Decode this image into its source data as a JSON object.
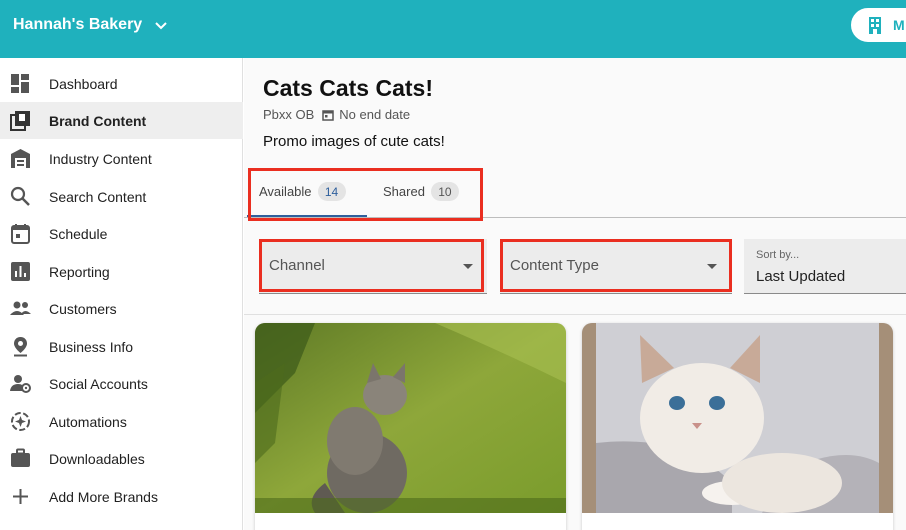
{
  "header": {
    "brand_name": "Hannah's Bakery",
    "location_button_label": "M"
  },
  "sidebar": {
    "items": [
      {
        "label": "Dashboard",
        "icon": "dashboard-icon"
      },
      {
        "label": "Brand Content",
        "icon": "library-icon",
        "active": true
      },
      {
        "label": "Industry Content",
        "icon": "warehouse-icon"
      },
      {
        "label": "Search Content",
        "icon": "search-icon"
      },
      {
        "label": "Schedule",
        "icon": "calendar-icon"
      },
      {
        "label": "Reporting",
        "icon": "bar-chart-icon"
      },
      {
        "label": "Customers",
        "icon": "people-icon"
      },
      {
        "label": "Business Info",
        "icon": "location-pin-icon"
      },
      {
        "label": "Social Accounts",
        "icon": "user-settings-icon"
      },
      {
        "label": "Automations",
        "icon": "automation-icon"
      },
      {
        "label": "Downloadables",
        "icon": "briefcase-icon"
      },
      {
        "label": "Add More Brands",
        "icon": "plus-icon"
      }
    ]
  },
  "content": {
    "title": "Cats Cats Cats!",
    "owner": "Pbxx OB",
    "end_date": "No end date",
    "description": "Promo images of cute cats!",
    "tabs": [
      {
        "label": "Available",
        "count": "14",
        "active": true
      },
      {
        "label": "Shared",
        "count": "10"
      }
    ],
    "filters": {
      "channel_label": "Channel",
      "content_type_label": "Content Type",
      "sort_small_label": "Sort by...",
      "sort_value": "Last Updated"
    },
    "cards": [
      {
        "image": "kitten-in-grass-photo"
      },
      {
        "image": "fluffy-white-kitten-photo"
      }
    ]
  },
  "colors": {
    "topbar": "#1fb1bd",
    "highlight_box": "#ea2e20",
    "tab_underline": "#2e5f9c"
  }
}
